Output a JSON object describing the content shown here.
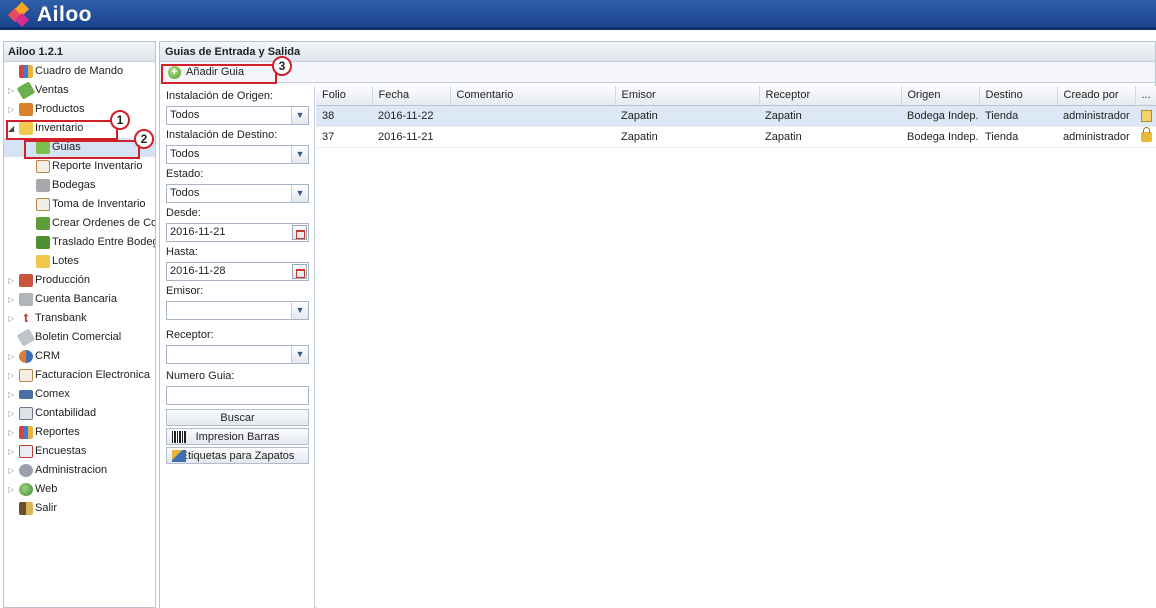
{
  "app": {
    "logo_text": "Ailoo",
    "version": "Ailoo 1.2.1"
  },
  "sidebar": {
    "items": [
      {
        "label": "Cuadro de Mando",
        "icon": "dashboard-icon"
      },
      {
        "label": "Ventas",
        "icon": "sales-icon"
      },
      {
        "label": "Productos",
        "icon": "products-icon"
      },
      {
        "label": "Inventario",
        "icon": "inventory-icon"
      },
      {
        "label": "Guias",
        "icon": "guide-icon"
      },
      {
        "label": "Reporte Inventario",
        "icon": "report-icon"
      },
      {
        "label": "Bodegas",
        "icon": "warehouse-icon"
      },
      {
        "label": "Toma de Inventario",
        "icon": "stocktake-icon"
      },
      {
        "label": "Crear Ordenes de Comp",
        "icon": "purchase-order-icon"
      },
      {
        "label": "Traslado Entre Bodegas",
        "icon": "transfer-icon"
      },
      {
        "label": "Lotes",
        "icon": "lots-icon"
      },
      {
        "label": "Producción",
        "icon": "production-icon"
      },
      {
        "label": "Cuenta Bancaria",
        "icon": "bank-icon"
      },
      {
        "label": "Transbank",
        "icon": "transbank-icon"
      },
      {
        "label": "Boletin Comercial",
        "icon": "bulletin-icon"
      },
      {
        "label": "CRM",
        "icon": "crm-icon"
      },
      {
        "label": "Facturacion Electronica",
        "icon": "invoice-icon"
      },
      {
        "label": "Comex",
        "icon": "comex-icon"
      },
      {
        "label": "Contabilidad",
        "icon": "accounting-icon"
      },
      {
        "label": "Reportes",
        "icon": "reports-icon"
      },
      {
        "label": "Encuestas",
        "icon": "surveys-icon"
      },
      {
        "label": "Administracion",
        "icon": "admin-icon"
      },
      {
        "label": "Web",
        "icon": "web-icon"
      },
      {
        "label": "Salir",
        "icon": "exit-icon"
      }
    ]
  },
  "main": {
    "title": "Guias de Entrada y Salida",
    "add_button": "Añadir Guia"
  },
  "filters": {
    "origen_label": "Instalación de Origen:",
    "origen_value": "Todos",
    "destino_label": "Instalación de Destino:",
    "destino_value": "Todos",
    "estado_label": "Estado:",
    "estado_value": "Todos",
    "desde_label": "Desde:",
    "desde_value": "2016-11-21",
    "hasta_label": "Hasta:",
    "hasta_value": "2016-11-28",
    "emisor_label": "Emisor:",
    "emisor_value": "",
    "receptor_label": "Receptor:",
    "receptor_value": "",
    "numero_label": "Numero Guia:",
    "numero_value": "",
    "buscar": "Buscar",
    "impresion": "Impresion Barras",
    "etiquetas": "Etiquetas para Zapatos"
  },
  "grid": {
    "columns": [
      "Folio",
      "Fecha",
      "Comentario",
      "Emisor",
      "Receptor",
      "Origen",
      "Destino",
      "Creado por",
      "..."
    ],
    "rows": [
      {
        "folio": "38",
        "fecha": "2016-11-22",
        "comentario": "",
        "emisor": "Zapatin",
        "receptor": "Zapatin",
        "origen": "Bodega Indep...",
        "destino": "Tienda",
        "creado": "administrador",
        "status_icon": "edit-icon"
      },
      {
        "folio": "37",
        "fecha": "2016-11-21",
        "comentario": "",
        "emisor": "Zapatin",
        "receptor": "Zapatin",
        "origen": "Bodega Indep...",
        "destino": "Tienda",
        "creado": "administrador",
        "status_icon": "lock-icon"
      }
    ]
  },
  "annotations": [
    "1",
    "2",
    "3"
  ]
}
